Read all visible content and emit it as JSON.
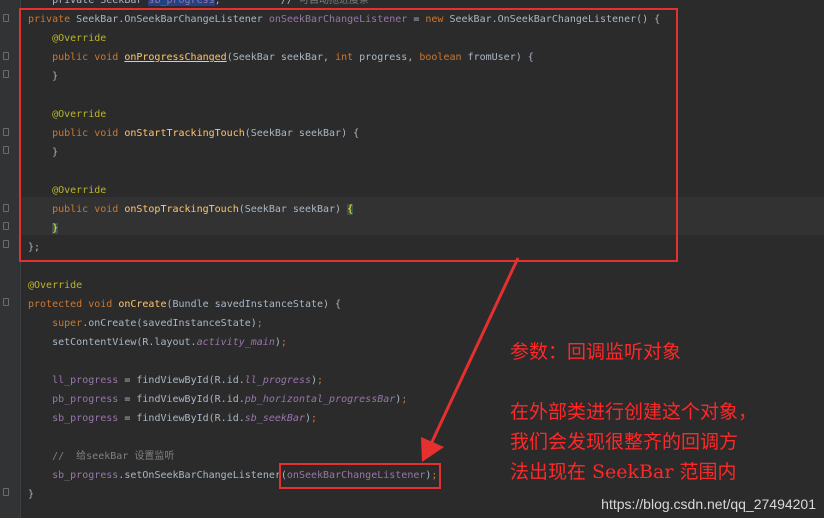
{
  "code_lines": [
    [
      {
        "t": "    private SeekBar ",
        "c": ""
      },
      {
        "t": "sb_progress",
        "c": "fld sel"
      },
      {
        "t": ";          // ",
        "c": ""
      },
      {
        "t": "可自动拖进度条",
        "c": "cmt"
      }
    ],
    [
      {
        "t": "private ",
        "c": "kw"
      },
      {
        "t": "SeekBar.OnSeekBarChangeListener ",
        "c": ""
      },
      {
        "t": "onSeekBarChangeListener",
        "c": "fld"
      },
      {
        "t": " = ",
        "c": ""
      },
      {
        "t": "new ",
        "c": "kw"
      },
      {
        "t": "SeekBar.OnSeekBarChangeListener() {",
        "c": ""
      }
    ],
    [
      {
        "t": "    @Override",
        "c": "ann"
      }
    ],
    [
      {
        "t": "    public void ",
        "c": "kw"
      },
      {
        "t": "onProgressChanged",
        "c": "fn ul"
      },
      {
        "t": "(SeekBar seekBar, ",
        "c": ""
      },
      {
        "t": "int ",
        "c": "kw"
      },
      {
        "t": "progress, ",
        "c": ""
      },
      {
        "t": "boolean ",
        "c": "kw"
      },
      {
        "t": "fromUser) {",
        "c": ""
      }
    ],
    [
      {
        "t": "    }",
        "c": ""
      }
    ],
    [],
    [
      {
        "t": "    @Override",
        "c": "ann"
      }
    ],
    [
      {
        "t": "    public void ",
        "c": "kw"
      },
      {
        "t": "onStartTrackingTouch",
        "c": "fn"
      },
      {
        "t": "(SeekBar seekBar) {",
        "c": ""
      }
    ],
    [
      {
        "t": "    }",
        "c": ""
      }
    ],
    [],
    [
      {
        "t": "    @Override",
        "c": "ann"
      }
    ],
    [
      {
        "t": "    public void ",
        "c": "kw"
      },
      {
        "t": "onStopTrackingTouch",
        "c": "fn"
      },
      {
        "t": "(SeekBar seekBar) ",
        "c": ""
      },
      {
        "t": "{",
        "c": "brace-hl"
      }
    ],
    [
      {
        "t": "    ",
        "c": ""
      },
      {
        "t": "}",
        "c": "brace-hl"
      }
    ],
    [
      {
        "t": "};",
        "c": ""
      }
    ],
    [],
    [
      {
        "t": "@Override",
        "c": "ann"
      }
    ],
    [
      {
        "t": "protected void ",
        "c": "kw"
      },
      {
        "t": "onCreate",
        "c": "fn"
      },
      {
        "t": "(Bundle savedInstanceState) {",
        "c": ""
      }
    ],
    [
      {
        "t": "    super",
        "c": "kw"
      },
      {
        "t": ".onCreate(savedInstanceState)",
        "c": ""
      },
      {
        "t": ";",
        "c": "kw"
      }
    ],
    [
      {
        "t": "    setContentView(R.layout.",
        "c": ""
      },
      {
        "t": "activity_main",
        "c": "fldi"
      },
      {
        "t": ")",
        "c": ""
      },
      {
        "t": ";",
        "c": "kw"
      }
    ],
    [],
    [
      {
        "t": "    ",
        "c": ""
      },
      {
        "t": "ll_progress",
        "c": "fld"
      },
      {
        "t": " = findViewById(R.id.",
        "c": ""
      },
      {
        "t": "ll_progress",
        "c": "fldi"
      },
      {
        "t": ")",
        "c": ""
      },
      {
        "t": ";",
        "c": "kw"
      }
    ],
    [
      {
        "t": "    ",
        "c": ""
      },
      {
        "t": "pb_progress",
        "c": "fld"
      },
      {
        "t": " = findViewById(R.id.",
        "c": ""
      },
      {
        "t": "pb_horizontal_progressBar",
        "c": "fldi"
      },
      {
        "t": ")",
        "c": ""
      },
      {
        "t": ";",
        "c": "kw"
      }
    ],
    [
      {
        "t": "    ",
        "c": ""
      },
      {
        "t": "sb_progress",
        "c": "fld"
      },
      {
        "t": " = findViewById(R.id.",
        "c": ""
      },
      {
        "t": "sb_seekBar",
        "c": "fldi"
      },
      {
        "t": ")",
        "c": ""
      },
      {
        "t": ";",
        "c": "kw"
      }
    ],
    [],
    [
      {
        "t": "    //  给seekBar 设置监听",
        "c": "cmt"
      }
    ],
    [
      {
        "t": "    ",
        "c": ""
      },
      {
        "t": "sb_progress",
        "c": "fld"
      },
      {
        "t": ".setOnSeekBarChangeListener(",
        "c": ""
      },
      {
        "t": "onSeekBarChangeListener",
        "c": "fld"
      },
      {
        "t": ")",
        "c": ""
      },
      {
        "t": ";",
        "c": "kw"
      }
    ],
    [
      {
        "t": "}",
        "c": ""
      }
    ]
  ],
  "annotation": {
    "title": "参数：回调监听对象",
    "body_lines": [
      "在外部类进行创建这个对象，",
      "我们会发现很整齐的回调方",
      "法出现在 SeekBar 范围内"
    ],
    "color": "#ff2828"
  },
  "watermark": "https://blog.csdn.net/qq_27494201",
  "colors": {
    "background": "#2b2b2b",
    "gutter": "#313335",
    "keyword": "#cc7832",
    "annotation": "#bbb529",
    "method": "#ffc66d",
    "field": "#9876aa",
    "comment": "#808080",
    "text": "#a9b7c6",
    "highlight_box": "#e53030"
  }
}
